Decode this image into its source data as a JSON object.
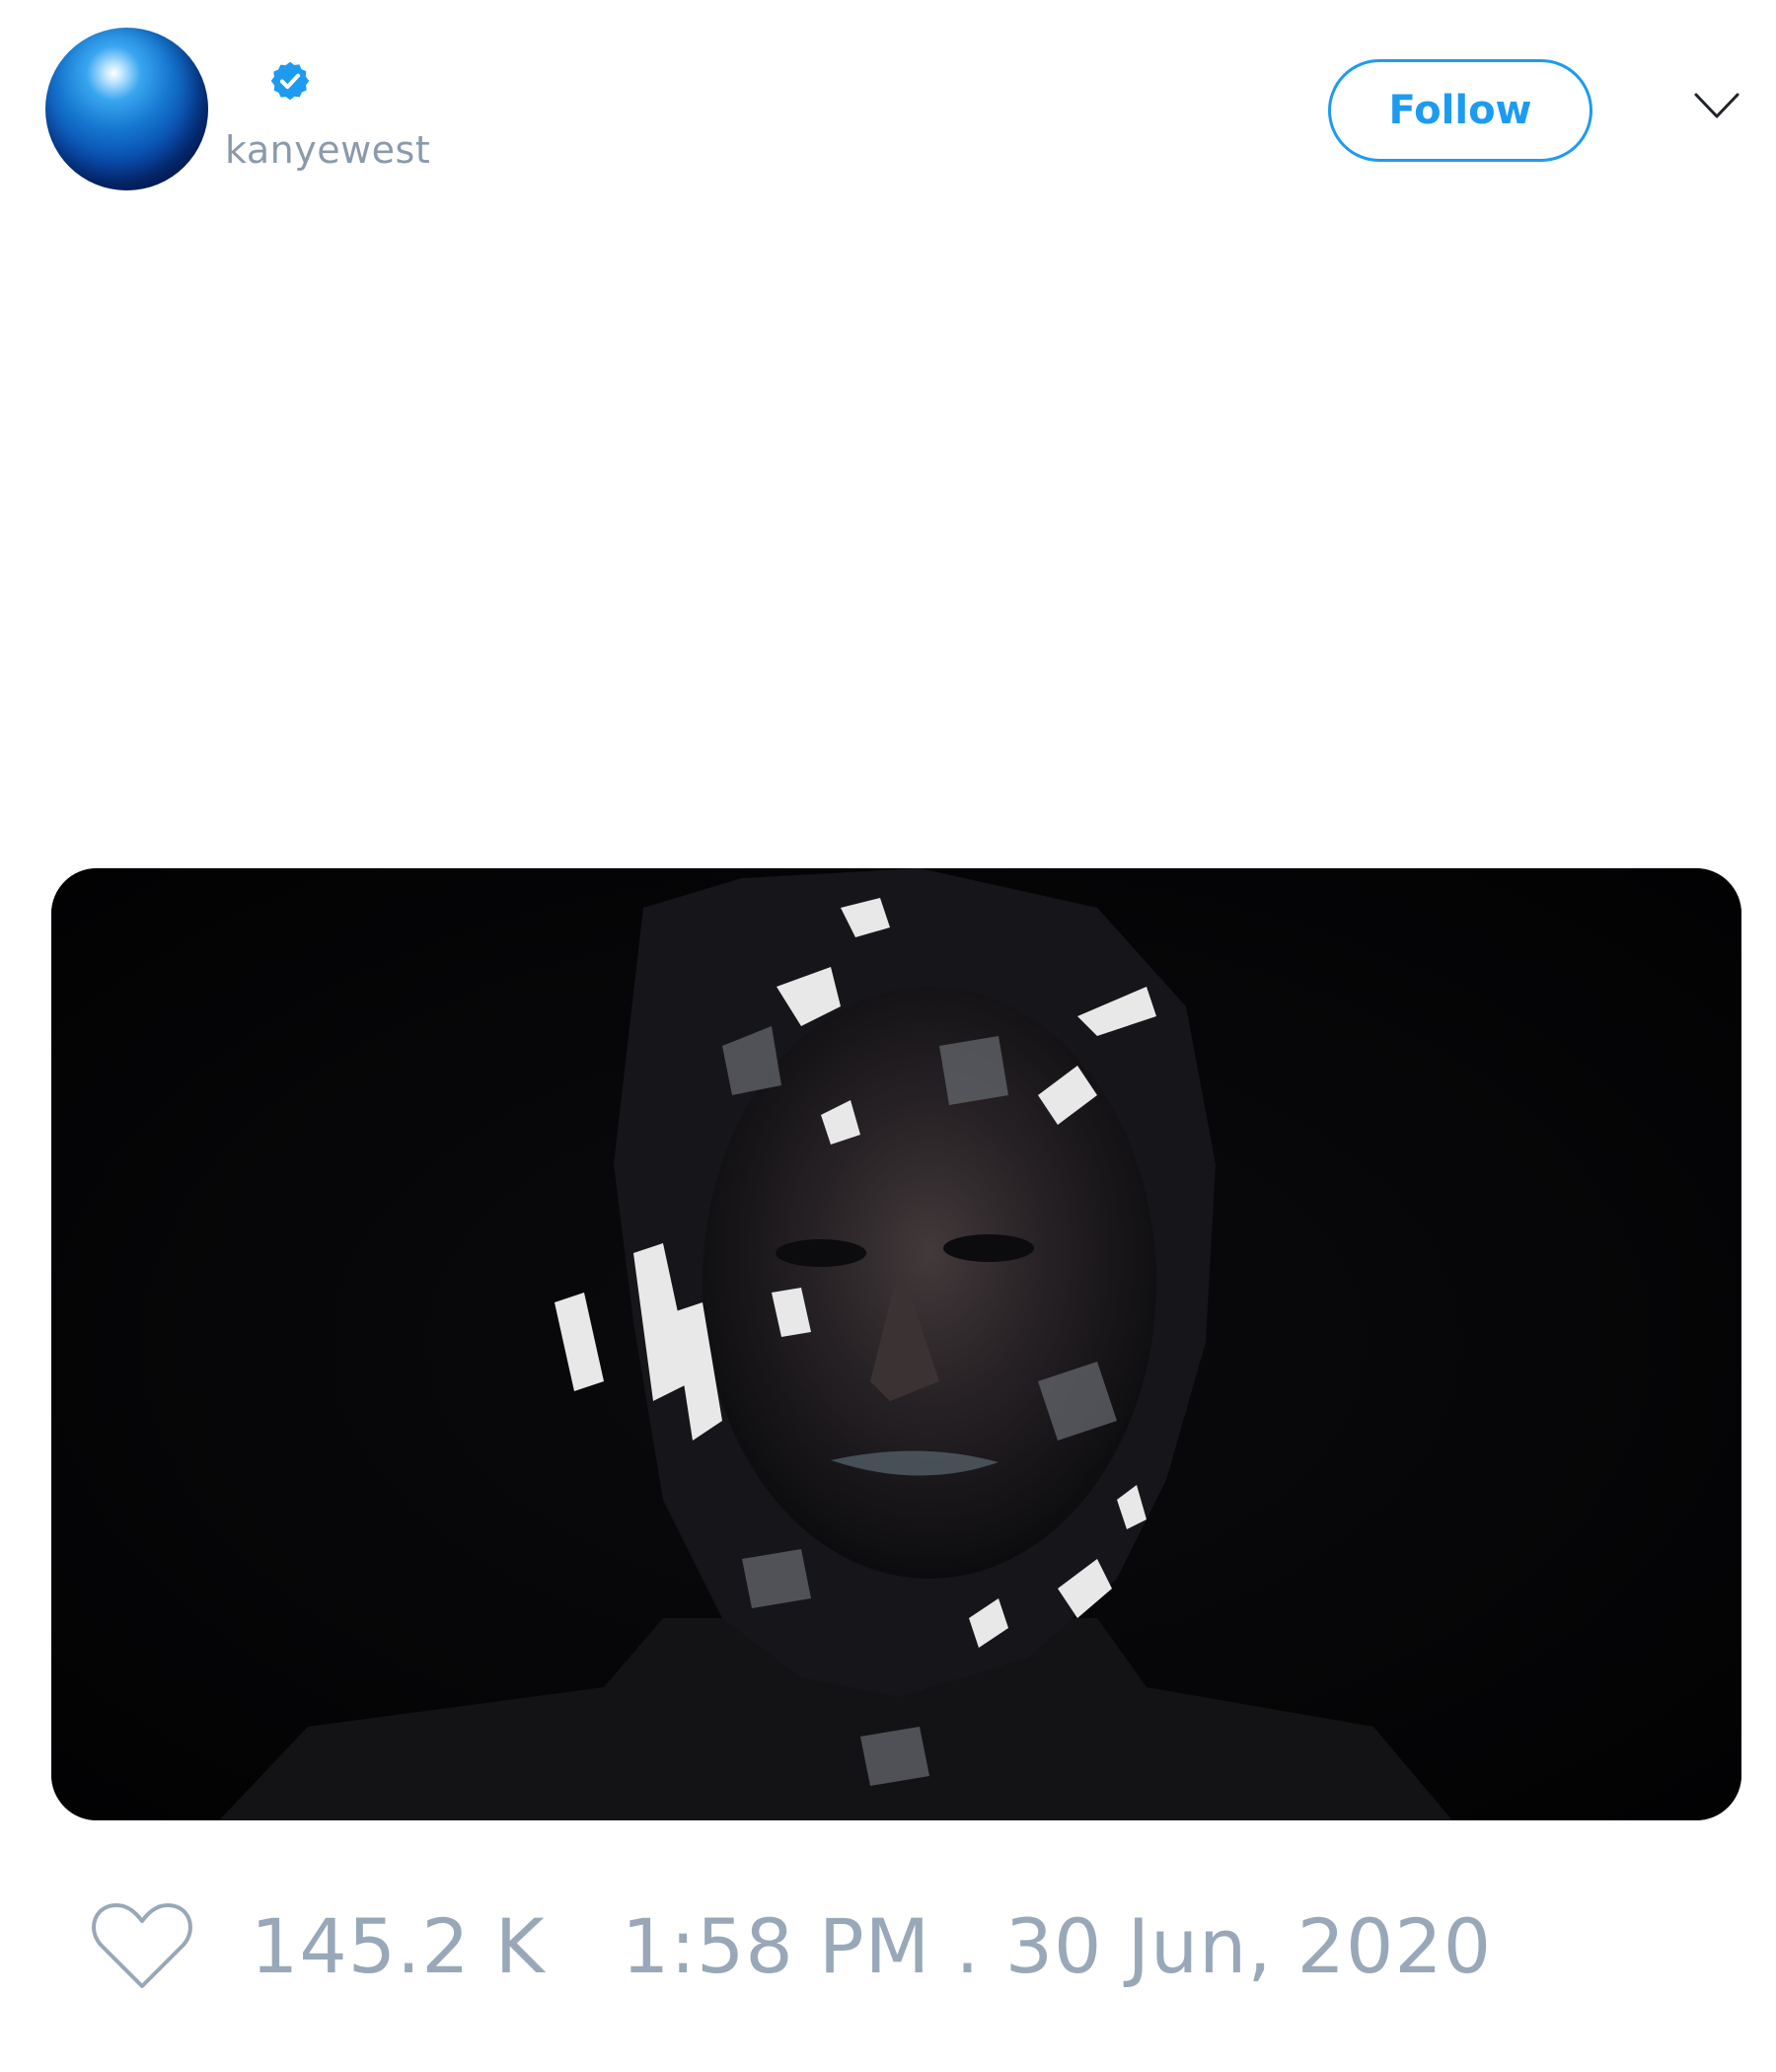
{
  "tweet": {
    "author": {
      "handle": "kanyewest",
      "verified": true,
      "avatar_icon": "blue-orb-avatar"
    },
    "actions": {
      "follow_label": "Follow",
      "more_icon": "chevron-down-icon"
    },
    "media": {
      "type": "image",
      "description_icon": "fractured-portrait-image"
    },
    "footer": {
      "like_icon": "heart-outline-icon",
      "likes_count": "145.2 K",
      "timestamp": "1:58 PM . 30 Jun, 2020"
    }
  },
  "colors": {
    "accent": "#1d9bf0",
    "muted_text": "#98a8b8",
    "background": "#ffffff",
    "media_background": "#030304"
  }
}
